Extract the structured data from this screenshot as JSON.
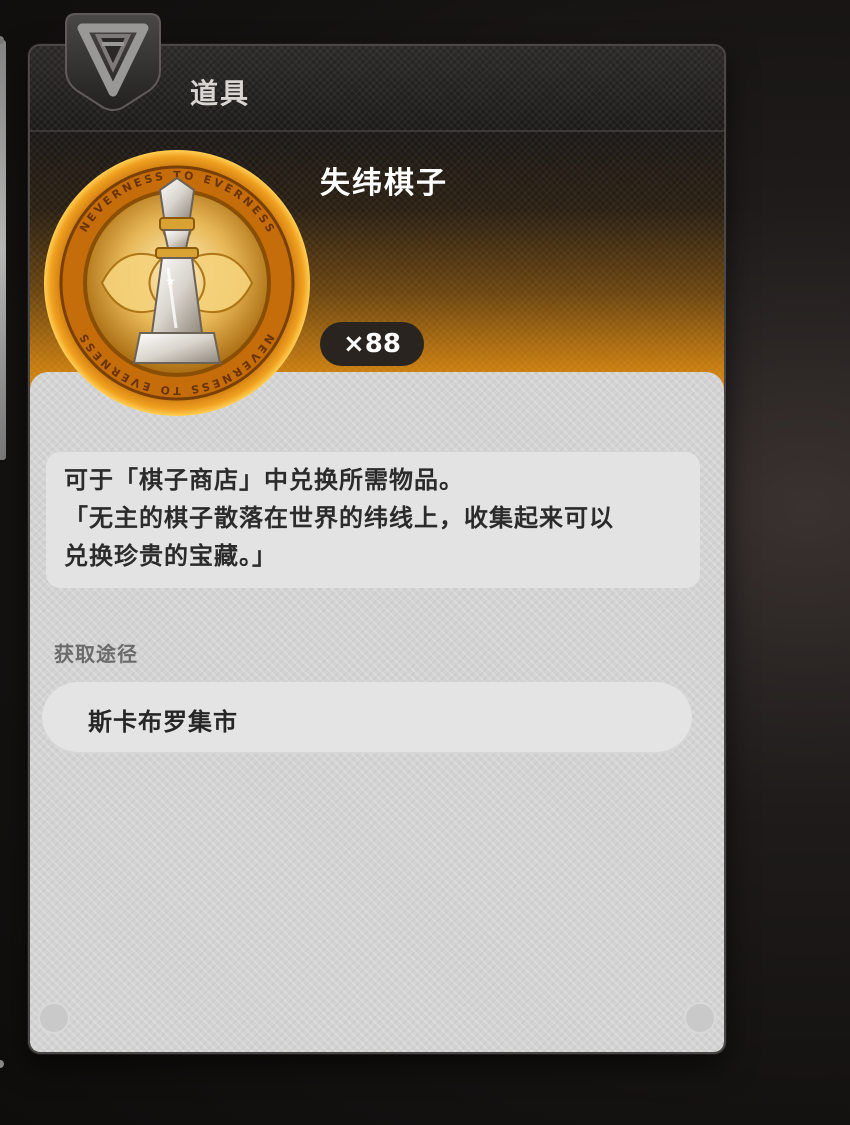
{
  "header": {
    "title": "道具",
    "emblem_icon": "chevron-emblem-icon"
  },
  "item": {
    "name": "失纬棋子",
    "quantity": "×88",
    "icon": "chess-piece-coin-icon",
    "coin_ring_text": "NEVERNESS TO EVERNESS",
    "accent_color": "#d98a10"
  },
  "description": {
    "lines": [
      "可于「棋子商店」中兑换所需物品。",
      "「无主的棋子散落在世界的纬线上，收集起来可以",
      "兑换珍贵的宝藏。」"
    ]
  },
  "acquisition": {
    "label": "获取途径",
    "sources": [
      "斯卡布罗集市"
    ]
  }
}
